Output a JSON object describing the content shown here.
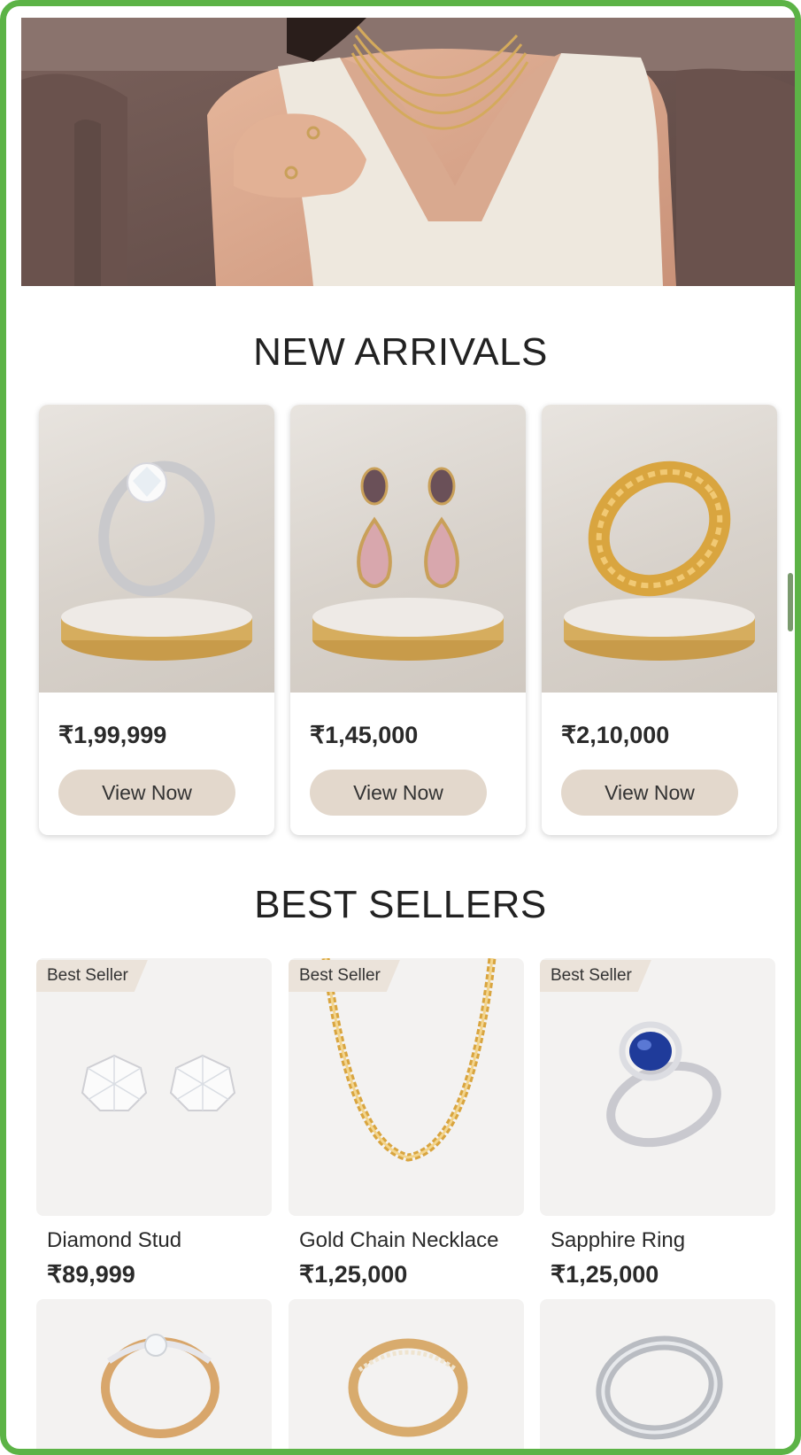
{
  "new_arrivals": {
    "title": "NEW ARRIVALS",
    "items": [
      {
        "price": "₹1,99,999",
        "button": "View Now",
        "icon": "diamond-ring-icon"
      },
      {
        "price": "₹1,45,000",
        "button": "View Now",
        "icon": "drop-earrings-icon"
      },
      {
        "price": "₹2,10,000",
        "button": "View Now",
        "icon": "gold-bracelet-icon"
      }
    ]
  },
  "best_sellers": {
    "title": "BEST SELLERS",
    "items": [
      {
        "badge": "Best Seller",
        "name": "Diamond Stud",
        "price": "₹89,999",
        "icon": "diamond-stud-earrings-icon"
      },
      {
        "badge": "Best Seller",
        "name": "Gold Chain Necklace",
        "price": "₹1,25,000",
        "icon": "gold-chain-icon"
      },
      {
        "badge": "Best Seller",
        "name": "Sapphire Ring",
        "price": "₹1,25,000",
        "icon": "sapphire-ring-icon"
      }
    ]
  },
  "colors": {
    "frame_border": "#5cb346",
    "button_bg": "#e3d8cc",
    "badge_bg": "#ebe3da",
    "text": "#2a2a2a"
  }
}
